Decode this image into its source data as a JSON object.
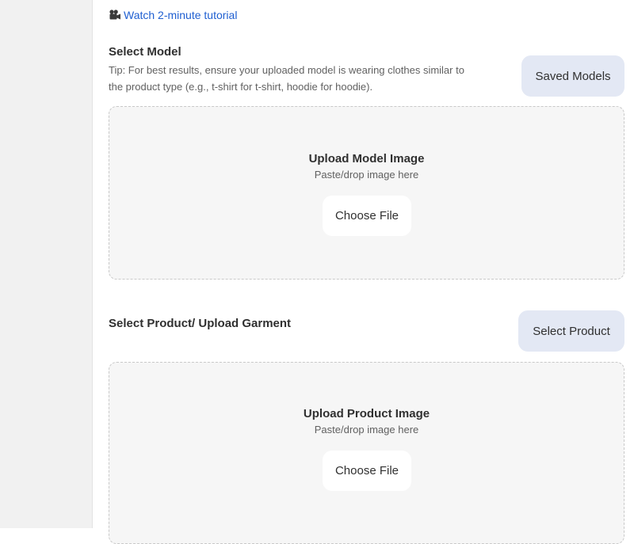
{
  "tutorial": {
    "icon": "movie-camera-icon",
    "label": "Watch 2-minute tutorial",
    "color": "#1f5fd1"
  },
  "model_section": {
    "title": "Select Model",
    "tip": "Tip: For best results, ensure your uploaded model is wearing clothes similar to the product type (e.g., t-shirt for t-shirt, hoodie for hoodie).",
    "saved_button_label": "Saved Models",
    "dropzone": {
      "title": "Upload Model Image",
      "hint": "Paste/drop image here",
      "button_label": "Choose File"
    }
  },
  "product_section": {
    "title": "Select Product/ Upload Garment",
    "select_button_label": "Select Product",
    "dropzone": {
      "title": "Upload Product Image",
      "hint": "Paste/drop image here",
      "button_label": "Choose File"
    }
  },
  "colors": {
    "pill_button_bg": "#e3e8f4",
    "dropzone_bg": "#f6f6f6",
    "sidebar_bg": "#f1f1f1"
  }
}
